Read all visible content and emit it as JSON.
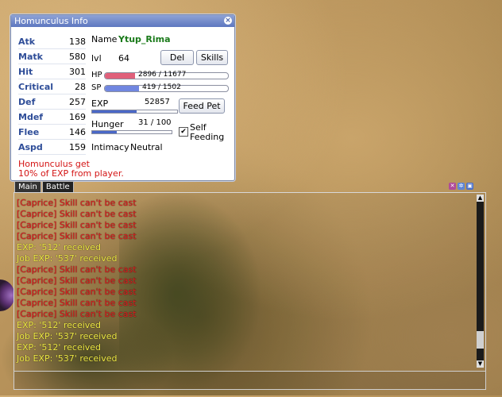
{
  "homunculus": {
    "title": "Homunculus Info",
    "stats": [
      {
        "label": "Atk",
        "value": "138"
      },
      {
        "label": "Matk",
        "value": "580"
      },
      {
        "label": "Hit",
        "value": "301"
      },
      {
        "label": "Critical",
        "value": "28"
      },
      {
        "label": "Def",
        "value": "257"
      },
      {
        "label": "Mdef",
        "value": "169"
      },
      {
        "label": "Flee",
        "value": "146"
      },
      {
        "label": "Aspd",
        "value": "159"
      }
    ],
    "name_label": "Name",
    "name_value": "Ytup_Rima",
    "lvl_label": "lvl",
    "lvl_value": "64",
    "del_button": "Del",
    "skills_button": "Skills",
    "hp_label": "HP",
    "hp_text": "2896  /  11677",
    "hp_fraction": 0.248,
    "sp_label": "SP",
    "sp_text": "419  /  1502",
    "sp_fraction": 0.279,
    "exp_label": "EXP",
    "exp_value": "52857",
    "exp_fraction": 0.52,
    "feed_button": "Feed Pet",
    "hunger_label": "Hunger",
    "hunger_text": "31 / 100",
    "hunger_fraction": 0.31,
    "self_feeding_line1": "Self",
    "self_feeding_line2": "Feeding",
    "self_feeding_checked": true,
    "intimacy_label": "Intimacy",
    "intimacy_value": "Neutral",
    "message_line1": "Homunculus get",
    "message_line2": "10% of EXP from player."
  },
  "chat": {
    "tabs": [
      "Main",
      "Battle"
    ],
    "active_tab": "Battle",
    "lines": [
      {
        "text": "[Caprice] Skill can't be cast",
        "color": "red"
      },
      {
        "text": "[Caprice] Skill can't be cast",
        "color": "red"
      },
      {
        "text": "[Caprice] Skill can't be cast",
        "color": "red"
      },
      {
        "text": "[Caprice] Skill can't be cast",
        "color": "red"
      },
      {
        "text": "EXP: '512' received",
        "color": "yellow"
      },
      {
        "text": "Job EXP: '537' received",
        "color": "yellow"
      },
      {
        "text": "[Caprice] Skill can't be cast",
        "color": "red"
      },
      {
        "text": "[Caprice] Skill can't be cast",
        "color": "red"
      },
      {
        "text": "[Caprice] Skill can't be cast",
        "color": "red"
      },
      {
        "text": "[Caprice] Skill can't be cast",
        "color": "red"
      },
      {
        "text": "[Caprice] Skill can't be cast",
        "color": "red"
      },
      {
        "text": "EXP: '512' received",
        "color": "yellow"
      },
      {
        "text": "Job EXP: '537' received",
        "color": "yellow"
      },
      {
        "text": "EXP: '512' received",
        "color": "yellow"
      },
      {
        "text": "Job EXP: '537' received",
        "color": "yellow"
      }
    ]
  },
  "colors": {
    "hp_fill": "#e0607a",
    "sp_fill": "#7086e0",
    "exp_fill": "#4a68c8",
    "hunger_fill": "#4a68c8",
    "error_text": "#e42020",
    "exp_text": "#f2ec46"
  }
}
